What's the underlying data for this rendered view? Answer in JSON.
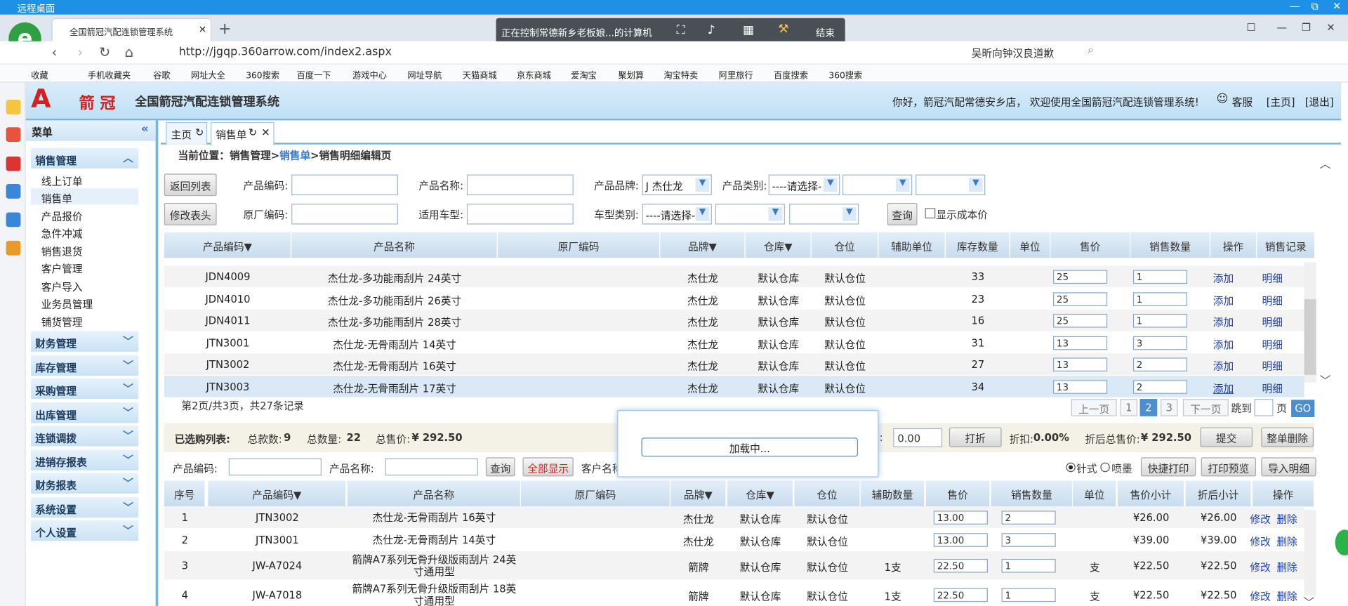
{
  "remote": {
    "title": "远程桌面"
  },
  "browser": {
    "tab_title": "全国箭冠汽配连锁管理系统",
    "control_text": "正在控制常德新乡老板娘...的计算机",
    "control_end": "结束",
    "url": "http://jgqp.360arrow.com/index2.aspx",
    "search_text": "吴昕向钟汉良道歉",
    "favorites": [
      "收藏",
      "手机收藏夹",
      "谷歌",
      "网址大全",
      "360搜索",
      "百度一下",
      "游戏中心",
      "网址导航",
      "天猫商城",
      "京东商城",
      "爱淘宝",
      "聚划算",
      "淘宝特卖",
      "阿里旅行",
      "百度搜索",
      "360搜索"
    ]
  },
  "header": {
    "logo": "箭 冠",
    "system_title": "全国箭冠汽配连锁管理系统",
    "welcome": "你好，箭冠汽配常德安乡店， 欢迎使用全国箭冠汽配连锁管理系统!",
    "service": "客服",
    "home_link": "[主页]",
    "logout_link": "[退出]"
  },
  "sidebar": {
    "title": "菜单",
    "sections": [
      {
        "label": "销售管理",
        "items": [
          "线上订单",
          "销售单",
          "产品报价",
          "急件冲减",
          "销售退货",
          "客户管理",
          "客户导入",
          "业务员管理",
          "铺货管理"
        ]
      },
      {
        "label": "财务管理"
      },
      {
        "label": "库存管理"
      },
      {
        "label": "采购管理"
      },
      {
        "label": "出库管理"
      },
      {
        "label": "连锁调拨"
      },
      {
        "label": "进销存报表"
      },
      {
        "label": "财务报表"
      },
      {
        "label": "系统设置"
      },
      {
        "label": "个人设置"
      }
    ]
  },
  "tabs": [
    {
      "label": "主页"
    },
    {
      "label": "销售单"
    }
  ],
  "breadcrumb": {
    "prefix": "当前位置：",
    "p1": "销售管理>",
    "p2": "销售单",
    ">p3": "",
    "p3": ">销售明细编辑页"
  },
  "filters": {
    "back_btn": "返回列表",
    "edit_head_btn": "修改表头",
    "code_label": "产品编码:",
    "name_label": "产品名称:",
    "brand_label": "产品品牌:",
    "brand_value": "J  杰仕龙",
    "category_label": "产品类别:",
    "category_value": "----请选择-",
    "oem_label": "原厂编码:",
    "model_label": "适用车型:",
    "cartype_label": "车型类别:",
    "cartype_value": "----请选择-",
    "query_btn": "查询",
    "show_cost": "显示成本价"
  },
  "product_table": {
    "headers": [
      "产品编码▼",
      "产品名称",
      "原厂编码",
      "品牌▼",
      "仓库▼",
      "仓位",
      "辅助单位",
      "库存数量",
      "单位",
      "售价",
      "销售数量",
      "操作",
      "销售记录"
    ],
    "rows": [
      {
        "code": "JDN4009",
        "name": "杰仕龙-多功能雨刮片 24英寸",
        "brand": "杰仕龙",
        "wh": "默认仓库",
        "loc": "默认仓位",
        "stock": "33",
        "price": "25",
        "qty": "1",
        "add": "添加",
        "detail": "明细"
      },
      {
        "code": "JDN4010",
        "name": "杰仕龙-多功能雨刮片 26英寸",
        "brand": "杰仕龙",
        "wh": "默认仓库",
        "loc": "默认仓位",
        "stock": "23",
        "price": "25",
        "qty": "1",
        "add": "添加",
        "detail": "明细"
      },
      {
        "code": "JDN4011",
        "name": "杰仕龙-多功能雨刮片 28英寸",
        "brand": "杰仕龙",
        "wh": "默认仓库",
        "loc": "默认仓位",
        "stock": "16",
        "price": "25",
        "qty": "1",
        "add": "添加",
        "detail": "明细"
      },
      {
        "code": "JTN3001",
        "name": "杰仕龙-无骨雨刮片 14英寸",
        "brand": "杰仕龙",
        "wh": "默认仓库",
        "loc": "默认仓位",
        "stock": "31",
        "price": "13",
        "qty": "3",
        "add": "添加",
        "detail": "明细"
      },
      {
        "code": "JTN3002",
        "name": "杰仕龙-无骨雨刮片 16英寸",
        "brand": "杰仕龙",
        "wh": "默认仓库",
        "loc": "默认仓位",
        "stock": "27",
        "price": "13",
        "qty": "2",
        "add": "添加",
        "detail": "明细"
      },
      {
        "code": "JTN3003",
        "name": "杰仕龙-无骨雨刮片 17英寸",
        "brand": "杰仕龙",
        "wh": "默认仓库",
        "loc": "默认仓位",
        "stock": "34",
        "price": "13",
        "qty": "2",
        "add": "添加",
        "detail": "明细"
      }
    ],
    "page_info": "第2页/共3页，共27条记录",
    "pager": {
      "prev": "上一页",
      "p1": "1",
      "p2": "2",
      "p3": "3",
      "next": "下一页",
      "jump": "跳到",
      "page": "页",
      "go": "GO"
    }
  },
  "selected": {
    "label": "已选购列表:",
    "count_label": "总款数:",
    "count": "9",
    "qty_label": "总数量:",
    "qty": "22",
    "total_label": "总售价:",
    "total": "¥ 292.50",
    "discount_value": "0.00",
    "discount_btn": "打折",
    "discount_label": "折扣:",
    "discount_pct": "0.00%",
    "after_label": "折后总售价:",
    "after": "¥ 292.50",
    "submit_btn": "提交",
    "delete_all_btn": "整单删除",
    "code_label": "产品编码:",
    "name_label": "产品名称:",
    "query_btn": "查询",
    "show_all_btn": "全部显示",
    "customer_label": "客户名称",
    "print_opt1": "针式",
    "print_opt2": "喷墨",
    "quick_print": "快捷打印",
    "preview": "打印预览",
    "import": "导入明细"
  },
  "loading": {
    "text": "加载中..."
  },
  "detail_table": {
    "headers": [
      "序号",
      "产品编码▼",
      "产品名称",
      "原厂编码",
      "品牌▼",
      "仓库▼",
      "仓位",
      "辅助数量",
      "售价",
      "销售数量",
      "单位",
      "售价小计",
      "折后小计",
      "操作"
    ],
    "rows": [
      {
        "no": "1",
        "code": "JTN3002",
        "name": "杰仕龙-无骨雨刮片 16英寸",
        "brand": "杰仕龙",
        "wh": "默认仓库",
        "loc": "默认仓位",
        "aux": "",
        "price": "13.00",
        "qty": "2",
        "unit": "",
        "sub": "¥26.00",
        "after": "¥26.00",
        "edit": "修改",
        "del": "删除"
      },
      {
        "no": "2",
        "code": "JTN3001",
        "name": "杰仕龙-无骨雨刮片 14英寸",
        "brand": "杰仕龙",
        "wh": "默认仓库",
        "loc": "默认仓位",
        "aux": "",
        "price": "13.00",
        "qty": "3",
        "unit": "",
        "sub": "¥39.00",
        "after": "¥39.00",
        "edit": "修改",
        "del": "删除"
      },
      {
        "no": "3",
        "code": "JW-A7024",
        "name": "箭牌A7系列无骨升级版雨刮片 24英寸通用型",
        "brand": "箭牌",
        "wh": "默认仓库",
        "loc": "默认仓位",
        "aux": "1支",
        "price": "22.50",
        "qty": "1",
        "unit": "支",
        "sub": "¥22.50",
        "after": "¥22.50",
        "edit": "修改",
        "del": "删除"
      },
      {
        "no": "4",
        "code": "JW-A7018",
        "name": "箭牌A7系列无骨升级版雨刮片 18英寸通用型",
        "brand": "箭牌",
        "wh": "默认仓库",
        "loc": "默认仓位",
        "aux": "1支",
        "price": "22.50",
        "qty": "1",
        "unit": "支",
        "sub": "¥22.50",
        "after": "¥22.50",
        "edit": "修改",
        "del": "删除"
      }
    ]
  }
}
